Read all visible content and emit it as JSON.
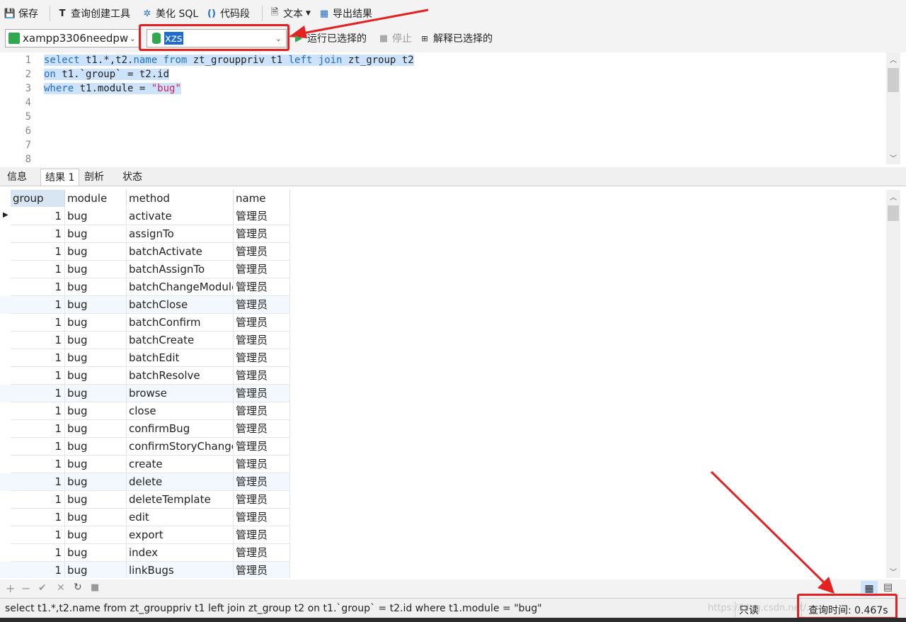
{
  "toolbar": {
    "save": "保存",
    "query_builder": "查询创建工具",
    "beautify": "美化 SQL",
    "snippet": "代码段",
    "text": "文本",
    "export": "导出结果"
  },
  "connection": {
    "name": "xampp3306needpw",
    "database": "xzs"
  },
  "actions": {
    "run_selected": "运行已选择的",
    "stop": "停止",
    "explain_selected": "解释已选择的"
  },
  "editor": {
    "line_numbers": [
      "1",
      "2",
      "3",
      "4",
      "5",
      "6",
      "7",
      "8"
    ],
    "lines": [
      [
        {
          "t": "select",
          "k": "kw"
        },
        {
          "t": " t1.*,t2.",
          "k": ""
        },
        {
          "t": "name",
          "k": "kw"
        },
        {
          "t": " ",
          "k": ""
        },
        {
          "t": "from",
          "k": "kw"
        },
        {
          "t": " zt_grouppriv t1 ",
          "k": ""
        },
        {
          "t": "left",
          "k": "kw"
        },
        {
          "t": " ",
          "k": ""
        },
        {
          "t": "join",
          "k": "kw"
        },
        {
          "t": " zt_group t2",
          "k": ""
        }
      ],
      [
        {
          "t": "on",
          "k": "kw"
        },
        {
          "t": " t1.`group` = t2.id",
          "k": ""
        }
      ],
      [
        {
          "t": "where",
          "k": "kw"
        },
        {
          "t": " t1.module = ",
          "k": ""
        },
        {
          "t": "\"bug\"",
          "k": "str"
        }
      ]
    ]
  },
  "tabs": [
    "信息",
    "结果 1",
    "剖析",
    "状态"
  ],
  "result": {
    "columns": [
      "group",
      "module",
      "method",
      "name"
    ],
    "rows": [
      [
        "1",
        "bug",
        "activate",
        "管理员"
      ],
      [
        "1",
        "bug",
        "assignTo",
        "管理员"
      ],
      [
        "1",
        "bug",
        "batchActivate",
        "管理员"
      ],
      [
        "1",
        "bug",
        "batchAssignTo",
        "管理员"
      ],
      [
        "1",
        "bug",
        "batchChangeModule",
        "管理员"
      ],
      [
        "1",
        "bug",
        "batchClose",
        "管理员"
      ],
      [
        "1",
        "bug",
        "batchConfirm",
        "管理员"
      ],
      [
        "1",
        "bug",
        "batchCreate",
        "管理员"
      ],
      [
        "1",
        "bug",
        "batchEdit",
        "管理员"
      ],
      [
        "1",
        "bug",
        "batchResolve",
        "管理员"
      ],
      [
        "1",
        "bug",
        "browse",
        "管理员"
      ],
      [
        "1",
        "bug",
        "close",
        "管理员"
      ],
      [
        "1",
        "bug",
        "confirmBug",
        "管理员"
      ],
      [
        "1",
        "bug",
        "confirmStoryChange",
        "管理员"
      ],
      [
        "1",
        "bug",
        "create",
        "管理员"
      ],
      [
        "1",
        "bug",
        "delete",
        "管理员"
      ],
      [
        "1",
        "bug",
        "deleteTemplate",
        "管理员"
      ],
      [
        "1",
        "bug",
        "edit",
        "管理员"
      ],
      [
        "1",
        "bug",
        "export",
        "管理员"
      ],
      [
        "1",
        "bug",
        "index",
        "管理员"
      ],
      [
        "1",
        "bug",
        "linkBugs",
        "管理员"
      ]
    ]
  },
  "status": {
    "sql": "select t1.*,t2.name from zt_grouppriv t1 left join zt_group t2 on t1.`group` = t2.id where t1.module = \"bug\"",
    "watermark": "https://blog.csdn.net/...",
    "readonly": "只读",
    "query_time": "查询时间: 0.467s"
  },
  "colors": {
    "keyword": "#1f6cd0",
    "string": "#d01f5c",
    "selection": "#cde3fb",
    "annotation": "#e52020"
  }
}
